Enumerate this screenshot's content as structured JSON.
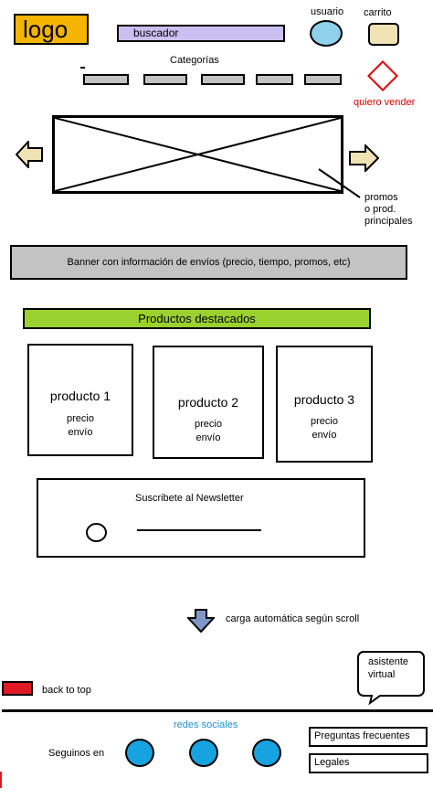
{
  "header": {
    "logo": "logo",
    "search_label": "buscador",
    "user_label": "usuario",
    "cart_label": "carrito",
    "categories_label": "Categorías",
    "sell_label": "quiero vender"
  },
  "carousel": {
    "note_lines": [
      "promos",
      "o prod.",
      "principales"
    ]
  },
  "shipping_banner": "Banner con información de envíos (precio, tiempo, promos, etc)",
  "featured": {
    "title": "Productos destacados",
    "products": [
      {
        "name": "producto 1",
        "price": "precio",
        "shipping": "envío"
      },
      {
        "name": "producto 2",
        "price": "precio",
        "shipping": "envío"
      },
      {
        "name": "producto 3",
        "price": "precio",
        "shipping": "envío"
      }
    ]
  },
  "newsletter": {
    "title": "Suscribete al Newsletter"
  },
  "autoload_label": "carga automática según scroll",
  "assistant": {
    "lines": [
      "asistente",
      "virtual"
    ]
  },
  "back_to_top": "back to top",
  "footer": {
    "social_title": "redes sociales",
    "follow_label": "Seguinos en",
    "links": [
      "Preguntas frecuentes",
      "Legales"
    ]
  },
  "colors": {
    "logo": "#f4b400",
    "search": "#c9bff0",
    "user": "#8fd0ea",
    "cart": "#efe2b5",
    "accent_red": "#e00000",
    "featured": "#9ad12f",
    "social": "#16a3e0"
  }
}
